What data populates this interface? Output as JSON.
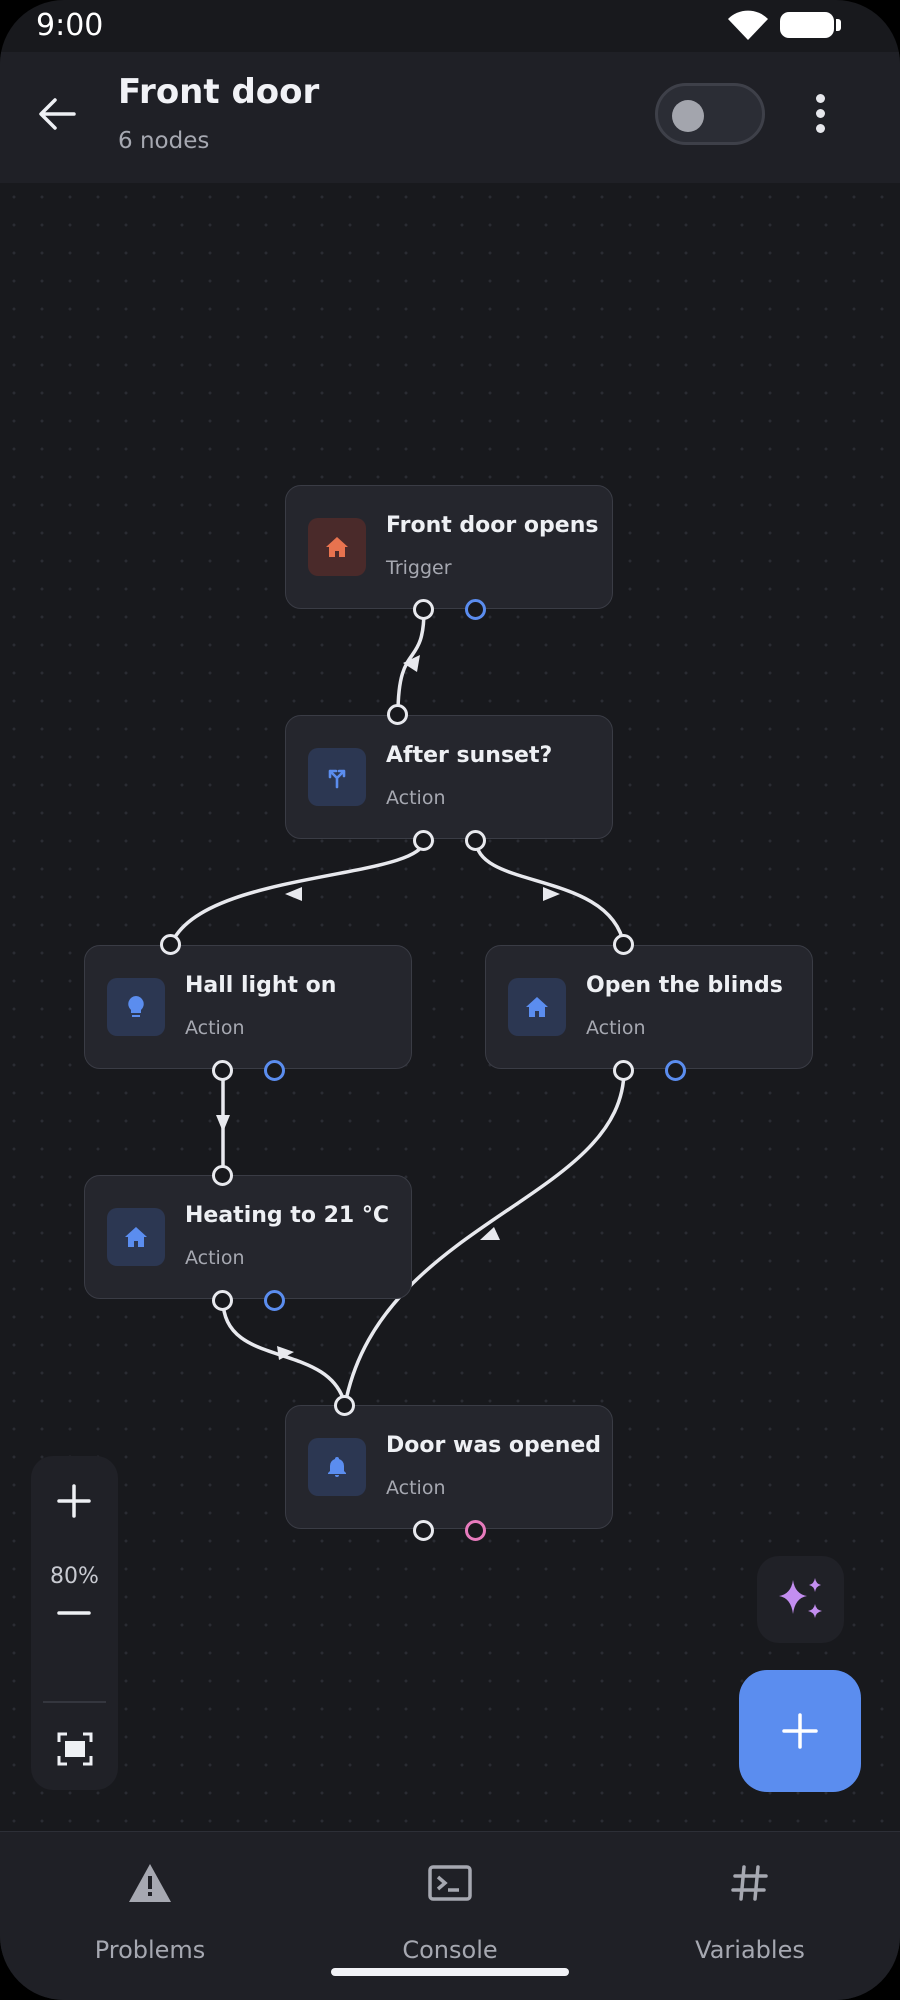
{
  "status_bar": {
    "time": "9:00"
  },
  "header": {
    "title": "Front door",
    "subtitle": "6 nodes",
    "back_icon": "arrow-left-icon",
    "more_icon": "more-vertical-icon",
    "enabled": false
  },
  "nodes": [
    {
      "title": "Front door opens",
      "type": "Trigger",
      "icon": "home-icon",
      "color": "#e8734f"
    },
    {
      "title": "After sunset?",
      "type": "Action",
      "icon": "branch-icon",
      "color": "#5b8def"
    },
    {
      "title": "Hall light on",
      "type": "Action",
      "icon": "lightbulb-icon",
      "color": "#5b8def"
    },
    {
      "title": "Open the blinds",
      "type": "Action",
      "icon": "home-icon",
      "color": "#5b8def"
    },
    {
      "title": "Heating to 21 °C",
      "type": "Action",
      "icon": "home-icon",
      "color": "#5b8def"
    },
    {
      "title": "Door was opened",
      "type": "Action",
      "icon": "bell-icon",
      "color": "#5b8def"
    }
  ],
  "zoom": {
    "level": "80%",
    "zoom_in_icon": "plus-icon",
    "zoom_out_icon": "minus-icon",
    "fit_icon": "fit-screen-icon"
  },
  "ai_button": {
    "icon": "sparkles-icon",
    "color": "#c38ef0"
  },
  "fab": {
    "icon": "plus-icon",
    "color": "#5b8def"
  },
  "bottom_nav": [
    {
      "label": "Problems",
      "icon": "warning-icon"
    },
    {
      "label": "Console",
      "icon": "terminal-icon"
    },
    {
      "label": "Variables",
      "icon": "hash-icon"
    }
  ]
}
